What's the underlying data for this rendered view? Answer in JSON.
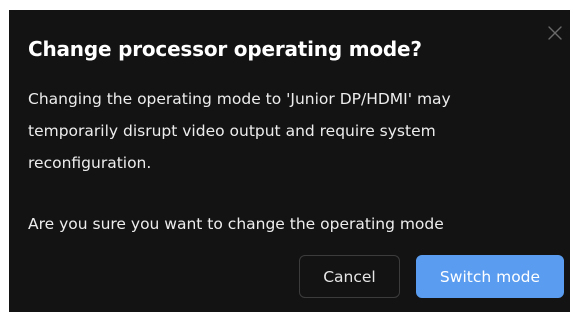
{
  "dialog": {
    "title": "Change processor operating mode?",
    "message_lines": [
      "Changing the operating mode to 'Junior DP/HDMI' may",
      "temporarily disrupt video output and require system",
      "reconfiguration."
    ],
    "confirm_text": "Are you sure you want to change the operating mode",
    "close_icon": "close-icon",
    "buttons": {
      "cancel_label": "Cancel",
      "confirm_label": "Switch mode"
    }
  },
  "colors": {
    "dialog_background": "#131313",
    "primary_button": "#5a9df0",
    "text": "#ededed"
  }
}
